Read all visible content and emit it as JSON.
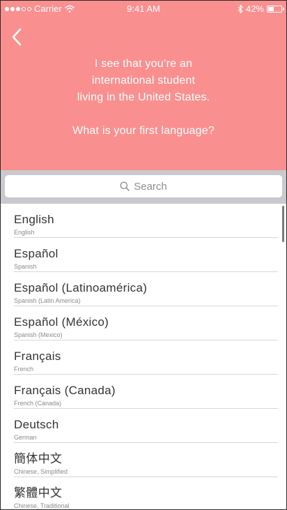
{
  "status_bar": {
    "carrier": "Carrier",
    "time": "9:41 AM",
    "battery": "42%",
    "battery_level": 0.42
  },
  "header": {
    "background_color": "#f9908f",
    "back_icon": "chevron-left-icon",
    "prompt_lines": [
      "I see that you’re an",
      "international student",
      "living in the United States."
    ],
    "question": "What is your first language?"
  },
  "search": {
    "placeholder": "Search",
    "icon": "search-icon"
  },
  "languages": [
    {
      "name": "English",
      "subtitle": "English"
    },
    {
      "name": "Español",
      "subtitle": "Spanish"
    },
    {
      "name": "Español (Latinoamérica)",
      "subtitle": "Spanish (Latin America)"
    },
    {
      "name": "Español (México)",
      "subtitle": "Spanish (Mexico)"
    },
    {
      "name": "Français",
      "subtitle": "French"
    },
    {
      "name": "Français (Canada)",
      "subtitle": "French (Canada)"
    },
    {
      "name": "Deutsch",
      "subtitle": "German"
    },
    {
      "name": "簡体中文",
      "subtitle": "Chinese, Simplified"
    },
    {
      "name": "繁體中文",
      "subtitle": "Chinese, Traditional"
    }
  ]
}
